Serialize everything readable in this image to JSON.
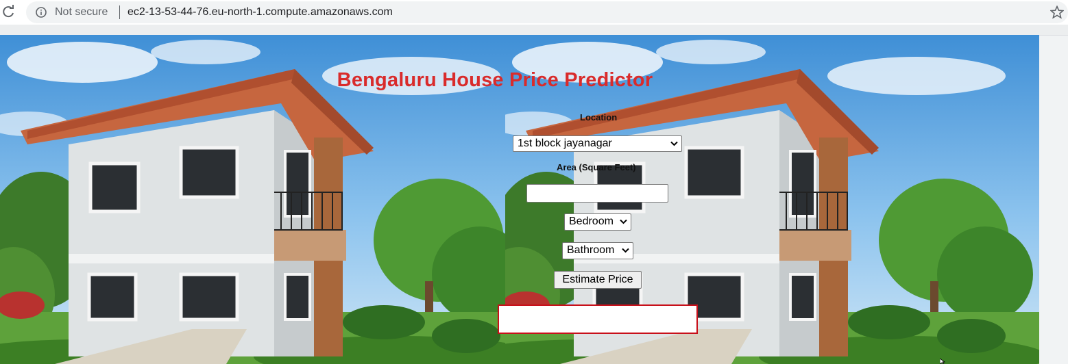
{
  "browser": {
    "security_label": "Not secure",
    "url": "ec2-13-53-44-76.eu-north-1.compute.amazonaws.com",
    "icons": [
      "reload-icon",
      "info-icon",
      "star-icon"
    ]
  },
  "app": {
    "title": "Bengaluru House Price Predictor",
    "title_color": "#d92b2b",
    "location_label": "Location",
    "location_selected": "1st block jayanagar",
    "area_label": "Area (Square Feet)",
    "area_value": "",
    "bedroom_selected": "Bedroom",
    "bathroom_selected": "Bathroom",
    "estimate_button": "Estimate Price",
    "result_text": "",
    "result_border_color": "#c8101a"
  }
}
